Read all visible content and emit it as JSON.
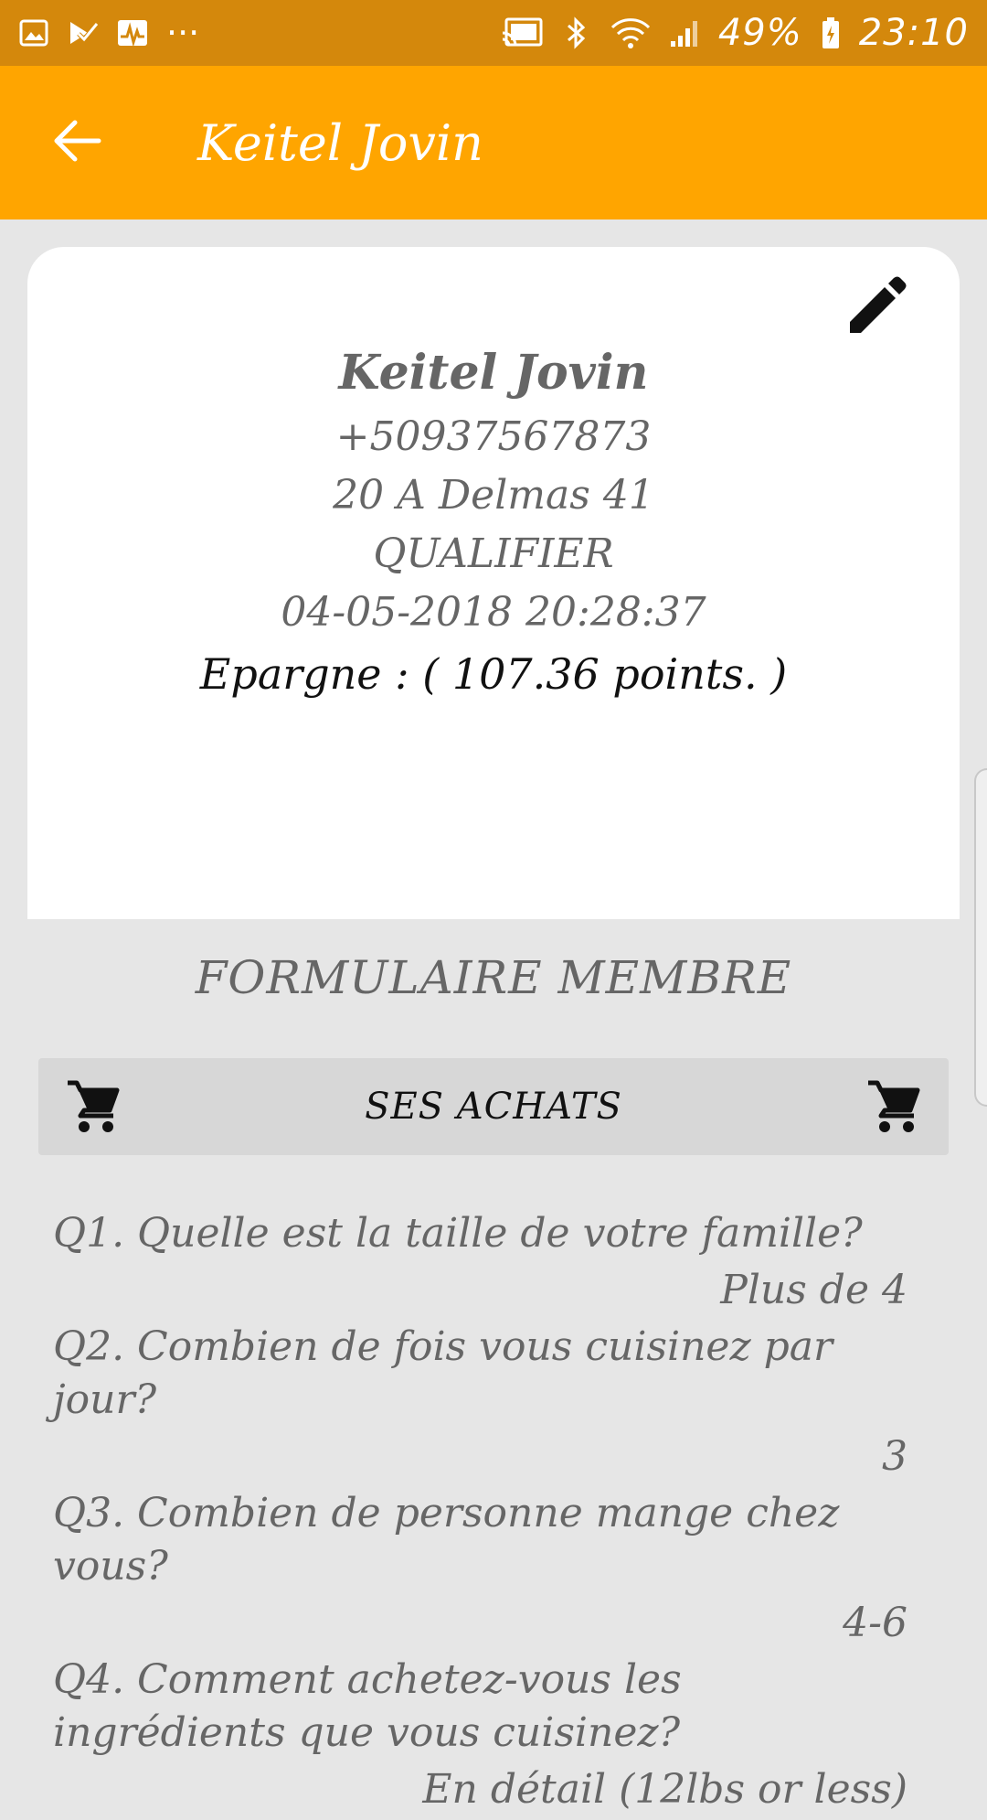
{
  "status_bar": {
    "battery": "49%",
    "time": "23:10",
    "overflow": "···",
    "icons_left": [
      "image-icon",
      "task-check-icon",
      "activity-icon"
    ],
    "icons_right": [
      "cast-icon",
      "bluetooth-icon",
      "wifi-icon",
      "signal-icon",
      "battery-icon"
    ]
  },
  "app_bar": {
    "title": "Keitel Jovin",
    "back_icon": "arrow-left-icon",
    "color": "#ffa500"
  },
  "profile": {
    "name": "Keitel Jovin",
    "phone": "+50937567873",
    "address": "20 A Delmas 41",
    "status": "QUALIFIER",
    "date": "04-05-2018 20:28:37",
    "savings": "Epargne : ( 107.36 points. )",
    "edit_icon": "pencil-icon"
  },
  "section_title": "FORMULAIRE MEMBRE",
  "purchases": {
    "label": "SES ACHATS",
    "icon": "cart-icon"
  },
  "questions": [
    {
      "question": "Q1. Quelle est la taille de votre famille?",
      "answer": "Plus de 4"
    },
    {
      "question": "Q2. Combien de fois vous cuisinez par jour?",
      "answer": "3"
    },
    {
      "question": "Q3. Combien de personne mange chez vous?",
      "answer": "4-6"
    },
    {
      "question": "Q4. Comment achetez-vous les ingrédients que vous cuisinez?",
      "answer": "En détail (12lbs or less)"
    }
  ]
}
